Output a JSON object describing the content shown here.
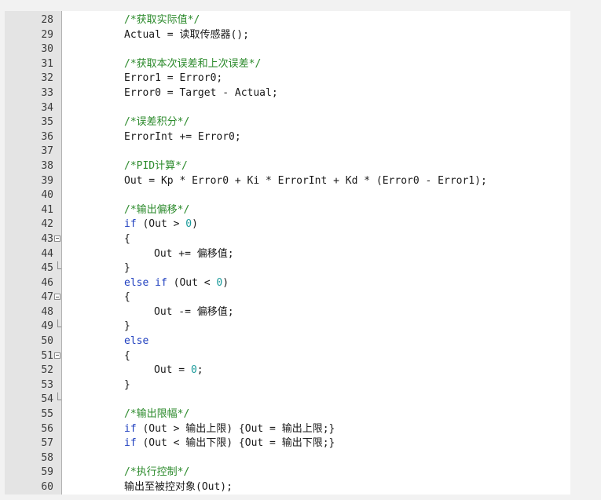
{
  "editor": {
    "lines": [
      {
        "n": "28",
        "parts": [
          {
            "t": "/*获取实际值*/",
            "c": "cm"
          }
        ]
      },
      {
        "n": "29",
        "parts": [
          {
            "t": "Actual = 读取传感器();",
            "c": "tx"
          }
        ]
      },
      {
        "n": "30",
        "parts": []
      },
      {
        "n": "31",
        "parts": [
          {
            "t": "/*获取本次误差和上次误差*/",
            "c": "cm"
          }
        ]
      },
      {
        "n": "32",
        "parts": [
          {
            "t": "Error1 = Error0;",
            "c": "tx"
          }
        ]
      },
      {
        "n": "33",
        "parts": [
          {
            "t": "Error0 = Target - Actual;",
            "c": "tx"
          }
        ]
      },
      {
        "n": "34",
        "parts": []
      },
      {
        "n": "35",
        "parts": [
          {
            "t": "/*误差积分*/",
            "c": "cm"
          }
        ]
      },
      {
        "n": "36",
        "parts": [
          {
            "t": "ErrorInt += Error0;",
            "c": "tx"
          }
        ]
      },
      {
        "n": "37",
        "parts": []
      },
      {
        "n": "38",
        "parts": [
          {
            "t": "/*PID计算*/",
            "c": "cm"
          }
        ]
      },
      {
        "n": "39",
        "parts": [
          {
            "t": "Out = Kp * Error0 + Ki * ErrorInt + Kd * (Error0 - Error1);",
            "c": "tx"
          }
        ]
      },
      {
        "n": "40",
        "parts": []
      },
      {
        "n": "41",
        "parts": [
          {
            "t": "/*输出偏移*/",
            "c": "cm"
          }
        ]
      },
      {
        "n": "42",
        "parts": [
          {
            "t": "if",
            "c": "kw"
          },
          {
            "t": " (Out > ",
            "c": "tx"
          },
          {
            "t": "0",
            "c": "num"
          },
          {
            "t": ")",
            "c": "tx"
          }
        ]
      },
      {
        "n": "43",
        "fold": "open",
        "parts": [
          {
            "t": "{",
            "c": "tx"
          }
        ]
      },
      {
        "n": "44",
        "indent": 2,
        "parts": [
          {
            "t": "Out += 偏移值;",
            "c": "tx"
          }
        ]
      },
      {
        "n": "45",
        "fold": "end",
        "parts": [
          {
            "t": "}",
            "c": "tx"
          }
        ]
      },
      {
        "n": "46",
        "parts": [
          {
            "t": "else if",
            "c": "kw"
          },
          {
            "t": " (Out < ",
            "c": "tx"
          },
          {
            "t": "0",
            "c": "num"
          },
          {
            "t": ")",
            "c": "tx"
          }
        ]
      },
      {
        "n": "47",
        "fold": "open",
        "parts": [
          {
            "t": "{",
            "c": "tx"
          }
        ]
      },
      {
        "n": "48",
        "indent": 2,
        "parts": [
          {
            "t": "Out -= 偏移值;",
            "c": "tx"
          }
        ]
      },
      {
        "n": "49",
        "fold": "end",
        "parts": [
          {
            "t": "}",
            "c": "tx"
          }
        ]
      },
      {
        "n": "50",
        "parts": [
          {
            "t": "else",
            "c": "kw"
          }
        ]
      },
      {
        "n": "51",
        "fold": "open",
        "parts": [
          {
            "t": "{",
            "c": "tx"
          }
        ]
      },
      {
        "n": "52",
        "indent": 2,
        "parts": [
          {
            "t": "Out = ",
            "c": "tx"
          },
          {
            "t": "0",
            "c": "num"
          },
          {
            "t": ";",
            "c": "tx"
          }
        ]
      },
      {
        "n": "53",
        "parts": [
          {
            "t": "}",
            "c": "tx"
          }
        ]
      },
      {
        "n": "54",
        "fold": "end",
        "parts": []
      },
      {
        "n": "55",
        "parts": [
          {
            "t": "/*输出限幅*/",
            "c": "cm"
          }
        ]
      },
      {
        "n": "56",
        "parts": [
          {
            "t": "if",
            "c": "kw"
          },
          {
            "t": " (Out > 输出上限) {Out = 输出上限;}",
            "c": "tx"
          }
        ]
      },
      {
        "n": "57",
        "parts": [
          {
            "t": "if",
            "c": "kw"
          },
          {
            "t": " (Out < 输出下限) {Out = 输出下限;}",
            "c": "tx"
          }
        ]
      },
      {
        "n": "58",
        "parts": []
      },
      {
        "n": "59",
        "parts": [
          {
            "t": "/*执行控制*/",
            "c": "cm"
          }
        ]
      },
      {
        "n": "60",
        "parts": [
          {
            "t": "输出至被控对象(Out);",
            "c": "tx"
          }
        ]
      }
    ]
  },
  "colors": {
    "comment": "#2b8a2b",
    "keyword": "#1f3fbf",
    "number": "#1a9a9a",
    "text": "#1a1a1a",
    "gutter": "#e4e4e4"
  }
}
